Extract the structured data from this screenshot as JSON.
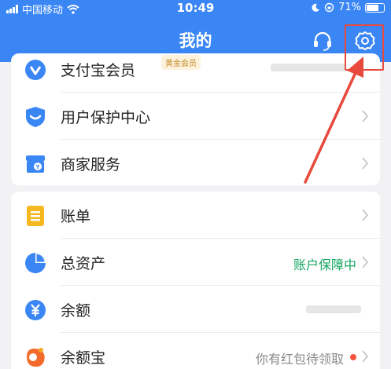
{
  "status_bar": {
    "carrier": "中国移动",
    "time": "10:49",
    "battery": "71%"
  },
  "header": {
    "title": "我的",
    "headset_icon": "headset-icon",
    "settings_icon": "gear-icon"
  },
  "colors": {
    "header_blue": "#3a86f4",
    "accent_green": "#17a862",
    "highlight_red": "#e74a3c"
  },
  "card1": {
    "items": [
      {
        "label": "支付宝会员",
        "badge": "黄金会员",
        "icon": "member-v-icon"
      },
      {
        "label": "用户保护中心",
        "icon": "shield-icon"
      },
      {
        "label": "商家服务",
        "icon": "shop-icon"
      }
    ]
  },
  "card2": {
    "items": [
      {
        "label": "账单",
        "icon": "bill-icon"
      },
      {
        "label": "总资产",
        "status": "账户保障中",
        "icon": "pie-chart-icon"
      },
      {
        "label": "余额",
        "icon": "yuan-icon"
      },
      {
        "label": "余额宝",
        "status": "你有红包待领取",
        "icon": "yuebao-icon"
      }
    ]
  }
}
